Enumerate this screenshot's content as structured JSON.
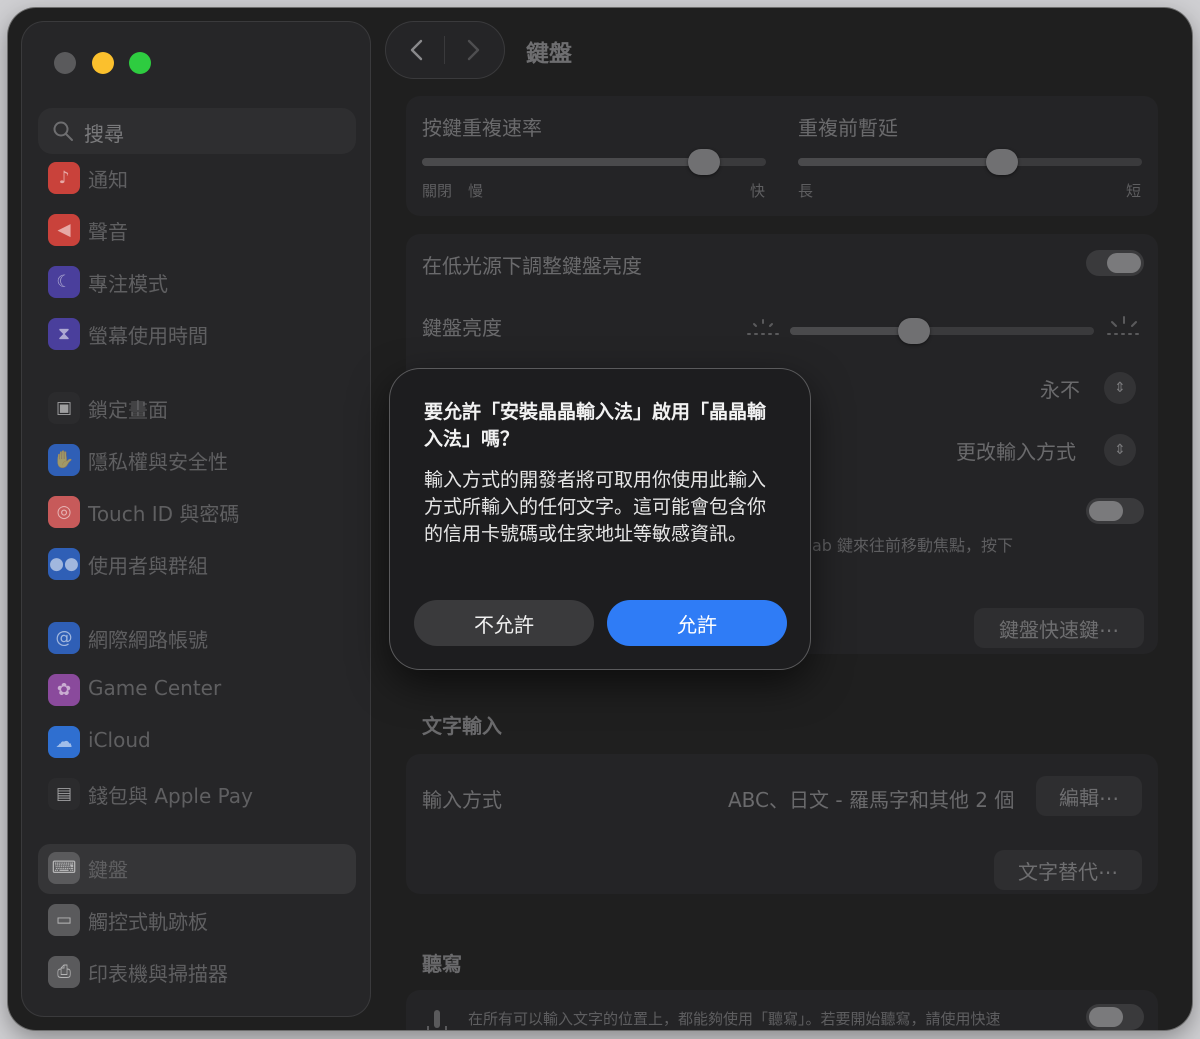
{
  "window": {
    "title": "鍵盤"
  },
  "sidebar": {
    "search_placeholder": "搜尋",
    "items": [
      {
        "label": "通知",
        "icon": "bell-icon",
        "color": "#c9423b"
      },
      {
        "label": "聲音",
        "icon": "speaker-icon",
        "color": "#c9423b"
      },
      {
        "label": "專注模式",
        "icon": "moon-icon",
        "color": "#4a3f9c"
      },
      {
        "label": "螢幕使用時間",
        "icon": "hourglass-icon",
        "color": "#4a3f9c"
      },
      {
        "label": "鎖定畫面",
        "icon": "lock-icon",
        "color": "#2b2b2d"
      },
      {
        "label": "隱私權與安全性",
        "icon": "hand-icon",
        "color": "#2f5fb6"
      },
      {
        "label": "Touch ID 與密碼",
        "icon": "fingerprint-icon",
        "color": "#c75a5a"
      },
      {
        "label": "使用者與群組",
        "icon": "users-icon",
        "color": "#2f5fb6"
      },
      {
        "label": "網際網路帳號",
        "icon": "at-icon",
        "color": "#2f5fb6"
      },
      {
        "label": "Game Center",
        "icon": "game-center-icon",
        "color": "#8a4a9c"
      },
      {
        "label": "iCloud",
        "icon": "cloud-icon",
        "color": "#2f6fd0"
      },
      {
        "label": "錢包與 Apple Pay",
        "icon": "wallet-icon",
        "color": "#2b2b2d"
      },
      {
        "label": "鍵盤",
        "icon": "keyboard-icon",
        "color": "#5a5a5c",
        "active": true
      },
      {
        "label": "觸控式軌跡板",
        "icon": "trackpad-icon",
        "color": "#5a5a5c"
      },
      {
        "label": "印表機與掃描器",
        "icon": "printer-icon",
        "color": "#5a5a5c"
      }
    ]
  },
  "keyboard": {
    "repeat_rate": {
      "label": "按鍵重複速率",
      "left1": "關閉",
      "left2": "慢",
      "right": "快",
      "level": 0.82
    },
    "delay": {
      "label": "重複前暫延",
      "left": "長",
      "right": "短",
      "level": 0.59
    },
    "low_light_label": "在低光源下調整鍵盤亮度",
    "brightness_label": "鍵盤亮度",
    "brightness_level": 0.44,
    "turn_off_value": "永不",
    "input_key_value": "更改輸入方式",
    "nav_hint": "ab 鍵來往前移動焦點，按下",
    "shortcuts_button": "鍵盤快速鍵⋯"
  },
  "text_input": {
    "heading": "文字輸入",
    "sources_label": "輸入方式",
    "sources_value": "ABC、日文 - 羅馬字和其他 2 個",
    "edit_button": "編輯⋯",
    "replacements_button": "文字替代⋯"
  },
  "dictation": {
    "heading": "聽寫",
    "description": "在所有可以輸入文字的位置上，都能夠使用「聽寫」。若要開始聽寫，請使用快速"
  },
  "dialog": {
    "title": "要允許「安裝晶晶輸入法」啟用「晶晶輸入法」嗎？",
    "body": "輸入方式的開發者將可取用你使用此輸入方式所輸入的任何文字。這可能會包含你的信用卡號碼或住家地址等敏感資訊。",
    "deny_button": "不允許",
    "allow_button": "允許"
  }
}
